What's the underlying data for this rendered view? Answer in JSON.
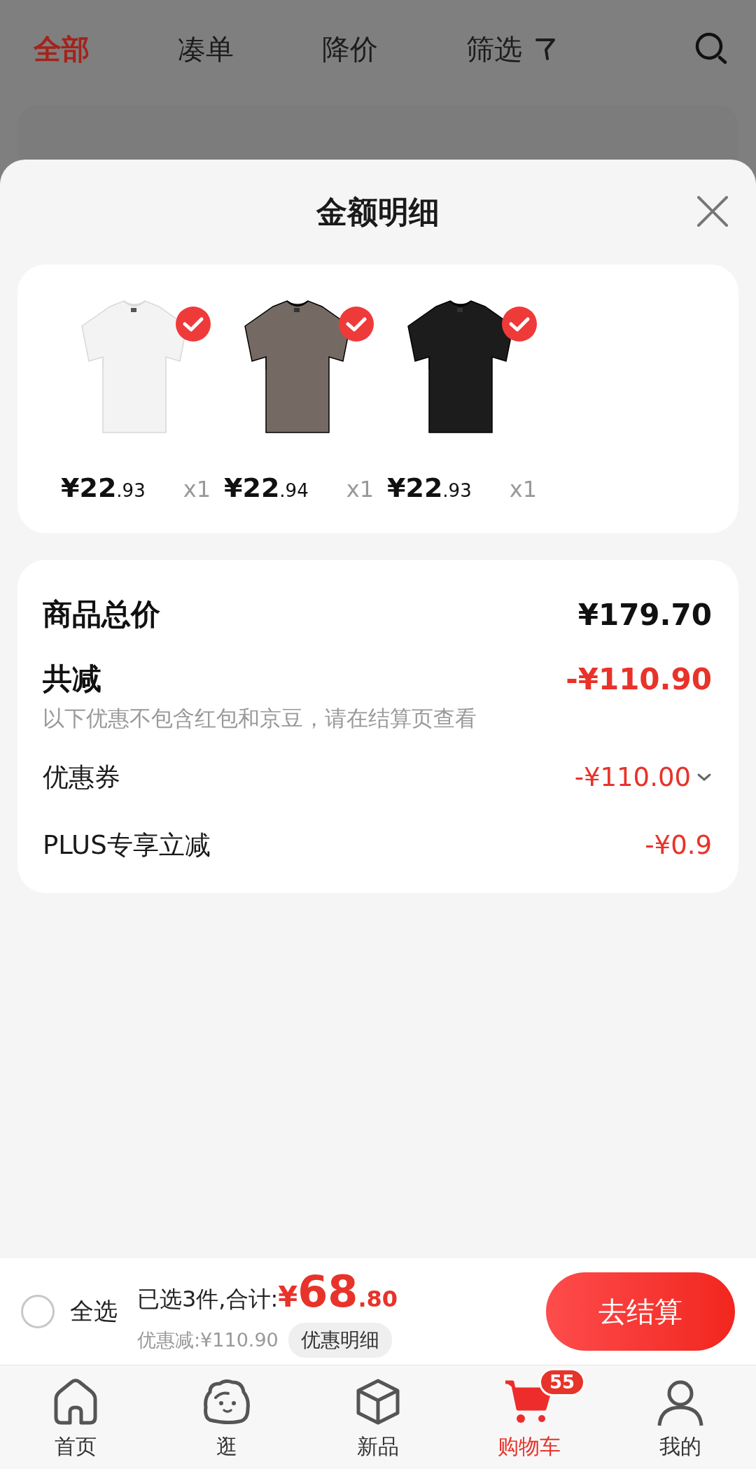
{
  "top_tabs": [
    {
      "label": "全部",
      "selected": true,
      "kind": "plain"
    },
    {
      "label": "凑单",
      "selected": false,
      "kind": "plain"
    },
    {
      "label": "降价",
      "selected": false,
      "kind": "plain"
    },
    {
      "label": "筛选",
      "selected": false,
      "kind": "filter"
    }
  ],
  "sheet": {
    "title": "金额明细",
    "products": [
      {
        "kind": "picture",
        "color": "#f3f3f3",
        "selected": true,
        "price": "¥22.93",
        "qty": "x1"
      },
      {
        "kind": "picture",
        "color": "#756a63",
        "selected": true,
        "price": "¥22.94",
        "qty": "x1"
      },
      {
        "kind": "picture",
        "color": "#1c1c1c",
        "selected": true,
        "price": "¥22.93",
        "qty": "x1"
      }
    ],
    "total": {
      "label": "商品总价",
      "value": "¥179.70"
    },
    "discount": {
      "label": "共减",
      "value": "-¥110.90",
      "note": "以下优惠不包含红包和京豆，请在结算页查看"
    },
    "rows": [
      {
        "label": "优惠券",
        "value": "-¥110.00",
        "expandable": true
      },
      {
        "label": "PLUS专享立减",
        "value": "-¥0.9",
        "expandable": false
      }
    ]
  },
  "checkout_bar": {
    "select_all": {
      "label": "全选",
      "checked": false
    },
    "summary": "已选3件,合计:",
    "amount": "¥68.80",
    "saving": "优惠减:¥110.90",
    "detail_button": "优惠明细",
    "checkout_button": "去结算"
  },
  "nav": [
    {
      "label": "首页",
      "kind": "home",
      "selected": false
    },
    {
      "label": "逛",
      "kind": "stroll",
      "selected": false
    },
    {
      "label": "新品",
      "kind": "box",
      "selected": false
    },
    {
      "label": "购物车",
      "kind": "cart",
      "selected": true,
      "badge": "55"
    },
    {
      "label": "我的",
      "kind": "user",
      "selected": false
    }
  ]
}
